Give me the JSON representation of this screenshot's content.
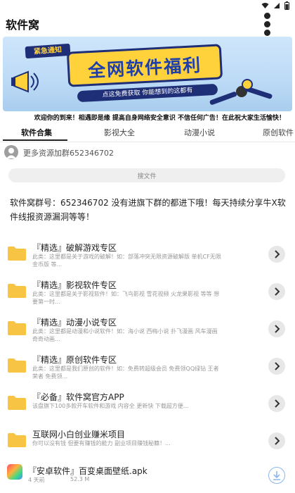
{
  "app": {
    "title": "软件窝"
  },
  "banner": {
    "tag": "紧急通知",
    "headline": "全网软件福利",
    "sub": "点这免费获取 你能想到的这都有"
  },
  "marquee": "欢迎你的到来！相遇即是缘 提高自身网络安全意识 不信任何广告！在此祝大家生活愉快！",
  "tabs": [
    "软件合集",
    "影视大全",
    "动漫小说",
    "原创软件"
  ],
  "active_tab": 0,
  "group_text": "更多资源加群652346702",
  "search": {
    "label": "搜文件"
  },
  "notice": "软件窝群号：652346702 没有进旗下群的都进下哦！每天持续分享牛X软件线报资源漏洞等等！",
  "items": [
    {
      "title": "『精选』破解游戏专区",
      "desc": "此类：这里都是关于游戏的破解！如：部落冲突无限资源破解版 单机CF无限金币版 等..."
    },
    {
      "title": "『精选』影视软件专区",
      "desc": "此类：这里都是关于影视软件！如：飞鸟影视 雪花视频 火龙果影视 等等 想要第一时..."
    },
    {
      "title": "『精选』动漫小说专区",
      "desc": "此类：这里都是动漫和小说软件！如：海小说 西梅小说 扑飞漫画 风车漫画 奇奇动画..."
    },
    {
      "title": "『精选』原创软件专区",
      "desc": "此类：这里都是我们原创的软件！如：免费转超级会员 免费领QQ绿钻 王者荣者 免费领..."
    },
    {
      "title": "『必备』软件窝官方APP",
      "desc": "该盘旗下100多款开车软件和游戏 内容全 更新快 下载超方便..."
    },
    {
      "title": "互联网小白创业赚米项目",
      "desc": "你可以没有钱 但要有赚钱的能力 副业项目赚钱秘籍！..."
    }
  ],
  "apk": {
    "title": "『安卓软件』百变桌面壁纸.apk",
    "age": "4 天前",
    "size": "52.3 M"
  },
  "colors": {
    "folder": "#f7c443",
    "banner_bg": "#bcdaf6",
    "banner_yellow": "#ffd23c",
    "banner_navy": "#1e2f78"
  }
}
